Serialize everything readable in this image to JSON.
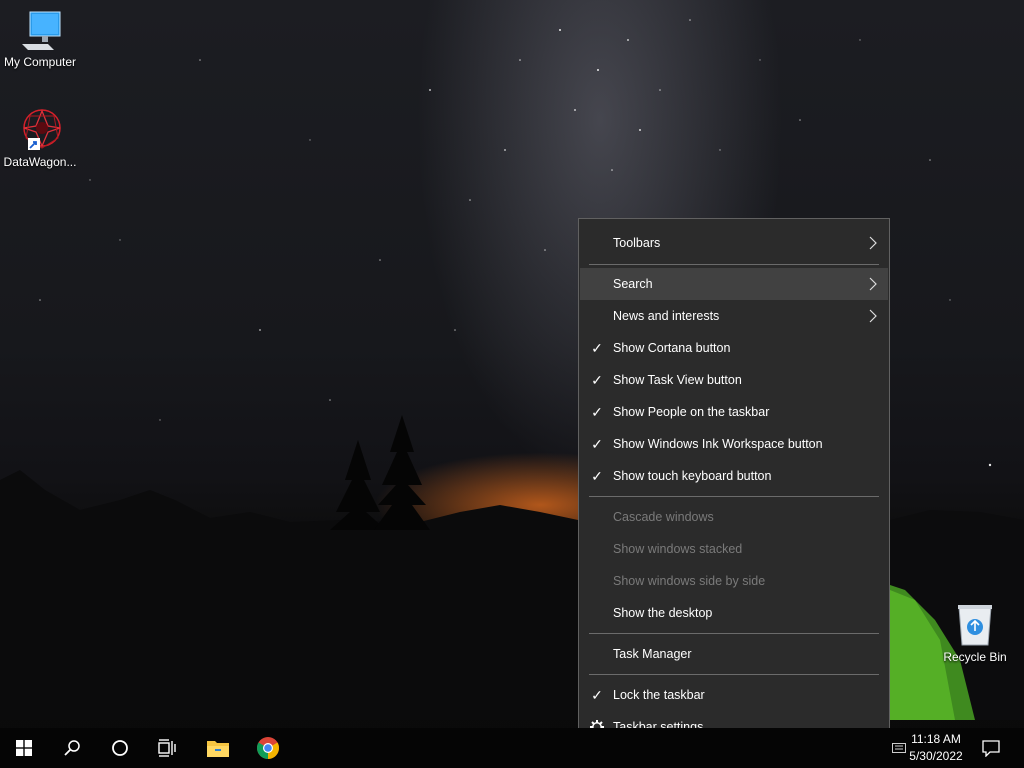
{
  "desktop": {
    "icons": [
      {
        "label": "My Computer",
        "icon": "computer-icon"
      },
      {
        "label": "DataWagon...",
        "icon": "app-shortcut-icon"
      },
      {
        "label": "Recycle Bin",
        "icon": "recycle-bin-icon"
      }
    ]
  },
  "context_menu": {
    "items": [
      {
        "label": "Toolbars",
        "checked": false,
        "submenu": true
      },
      {
        "label": "Search",
        "checked": false,
        "submenu": true,
        "highlighted": true
      },
      {
        "label": "News and interests",
        "checked": false,
        "submenu": true
      },
      {
        "label": "Show Cortana button",
        "checked": true
      },
      {
        "label": "Show Task View button",
        "checked": true
      },
      {
        "label": "Show People on the taskbar",
        "checked": true
      },
      {
        "label": "Show Windows Ink Workspace button",
        "checked": true
      },
      {
        "label": "Show touch keyboard button",
        "checked": true
      },
      {
        "label": "Cascade windows",
        "disabled": true
      },
      {
        "label": "Show windows stacked",
        "disabled": true
      },
      {
        "label": "Show windows side by side",
        "disabled": true
      },
      {
        "label": "Show the desktop"
      },
      {
        "label": "Task Manager"
      },
      {
        "label": "Lock the taskbar",
        "checked": true
      },
      {
        "label": "Taskbar settings",
        "icon": "gear-icon"
      }
    ],
    "check_glyph": "✓"
  },
  "taskbar": {
    "buttons": [
      "start-icon",
      "search-icon",
      "cortana-icon",
      "task-view-icon",
      "file-explorer-icon",
      "chrome-icon"
    ],
    "clock": {
      "time": "11:18 AM",
      "date": "5/30/2022"
    },
    "notification_icon": "action-center-icon"
  },
  "colors": {
    "menu_bg": "#2b2b2b",
    "menu_hover": "#414141",
    "menu_border": "#616161",
    "taskbar_bg": "#050505",
    "disabled_text": "#7a7a7a"
  }
}
